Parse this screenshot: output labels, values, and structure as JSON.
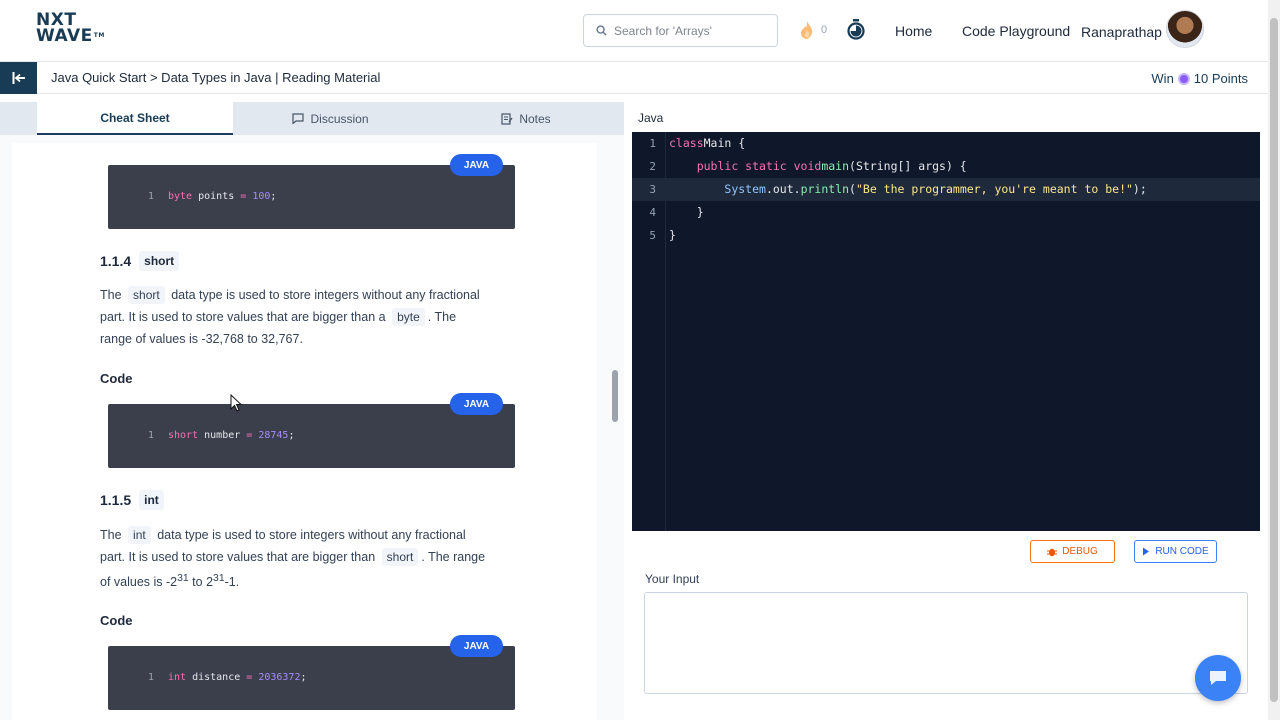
{
  "header": {
    "logo_line1": "NXT",
    "logo_line2": "WAVE",
    "logo_tm": "TM",
    "search_placeholder": "Search for 'Arrays'",
    "streak_count": "0",
    "nav_home": "Home",
    "nav_playground": "Code Playground",
    "username": "Ranaprathap"
  },
  "crumbbar": {
    "breadcrumb": "Java Quick Start > Data Types in Java | Reading Material",
    "win_label": "Win",
    "points_label": "10 Points"
  },
  "tabs": [
    {
      "label": "Cheat Sheet"
    },
    {
      "label": "Discussion"
    },
    {
      "label": "Notes"
    }
  ],
  "content": {
    "code1_line": "1",
    "code1_kw": "byte",
    "code1_rest": " points ",
    "code1_op": "=",
    "code1_num": " 100",
    "code1_end": ";",
    "java_tag": "JAVA",
    "sec_short_num": "1.1.4",
    "sec_short_chip": "short",
    "short_para_a": "The",
    "short_para_chip": "short",
    "short_para_b": "data type is used to store integers without any fractional",
    "short_para_c": "part. It is used to store values that are bigger than a",
    "short_para_chip2": "byte",
    "short_para_d": ". The",
    "short_para_e": "range of values is -32,768 to 32,767.",
    "code_label": "Code",
    "code2_line": "1",
    "code2_kw": "short",
    "code2_rest": " number ",
    "code2_op": "=",
    "code2_num": " 28745",
    "code2_end": ";",
    "sec_int_num": "1.1.5",
    "sec_int_chip": "int",
    "int_para_a": "The",
    "int_para_chip": "int",
    "int_para_b": "data type is used to store integers without any fractional",
    "int_para_c": "part. It is used to store values that are bigger than",
    "int_para_chip2": "short",
    "int_para_d": ". The range",
    "int_para_e1": "of values is -2",
    "int_para_sup1": "31",
    "int_para_e2": " to 2",
    "int_para_sup2": "31",
    "int_para_e3": "-1.",
    "code3_line": "1",
    "code3_kw": "int",
    "code3_rest": " distance ",
    "code3_op": "=",
    "code3_num": " 2036372",
    "code3_end": ";"
  },
  "editor": {
    "language": "Java",
    "lines": [
      {
        "n": "1",
        "parts": [
          [
            "ek",
            "class"
          ],
          [
            "",
            "Main {"
          ]
        ]
      },
      {
        "n": "2",
        "parts": [
          [
            "",
            "    "
          ],
          [
            "ek",
            "public static void"
          ],
          [
            "",
            ""
          ],
          [
            "ef",
            "main"
          ],
          [
            "",
            "(String[] args) {"
          ]
        ]
      },
      {
        "n": "3",
        "parts": [
          [
            "",
            "        "
          ],
          [
            "et",
            "System"
          ],
          [
            "",
            ".out."
          ],
          [
            "ef",
            "println"
          ],
          [
            "",
            "("
          ],
          [
            "es",
            "\"Be the programmer, you're meant to be!\""
          ],
          [
            "",
            ");"
          ]
        ]
      },
      {
        "n": "4",
        "parts": [
          [
            "",
            "    }"
          ]
        ]
      },
      {
        "n": "5",
        "parts": [
          [
            "",
            "}"
          ]
        ]
      }
    ],
    "debug_label": "DEBUG",
    "run_label": "RUN CODE",
    "input_label": "Your Input"
  },
  "colors": {
    "brand_dark": "#183b56",
    "accent_blue": "#2563eb",
    "debug_orange": "#ea580c",
    "editor_bg": "#0f172a"
  }
}
